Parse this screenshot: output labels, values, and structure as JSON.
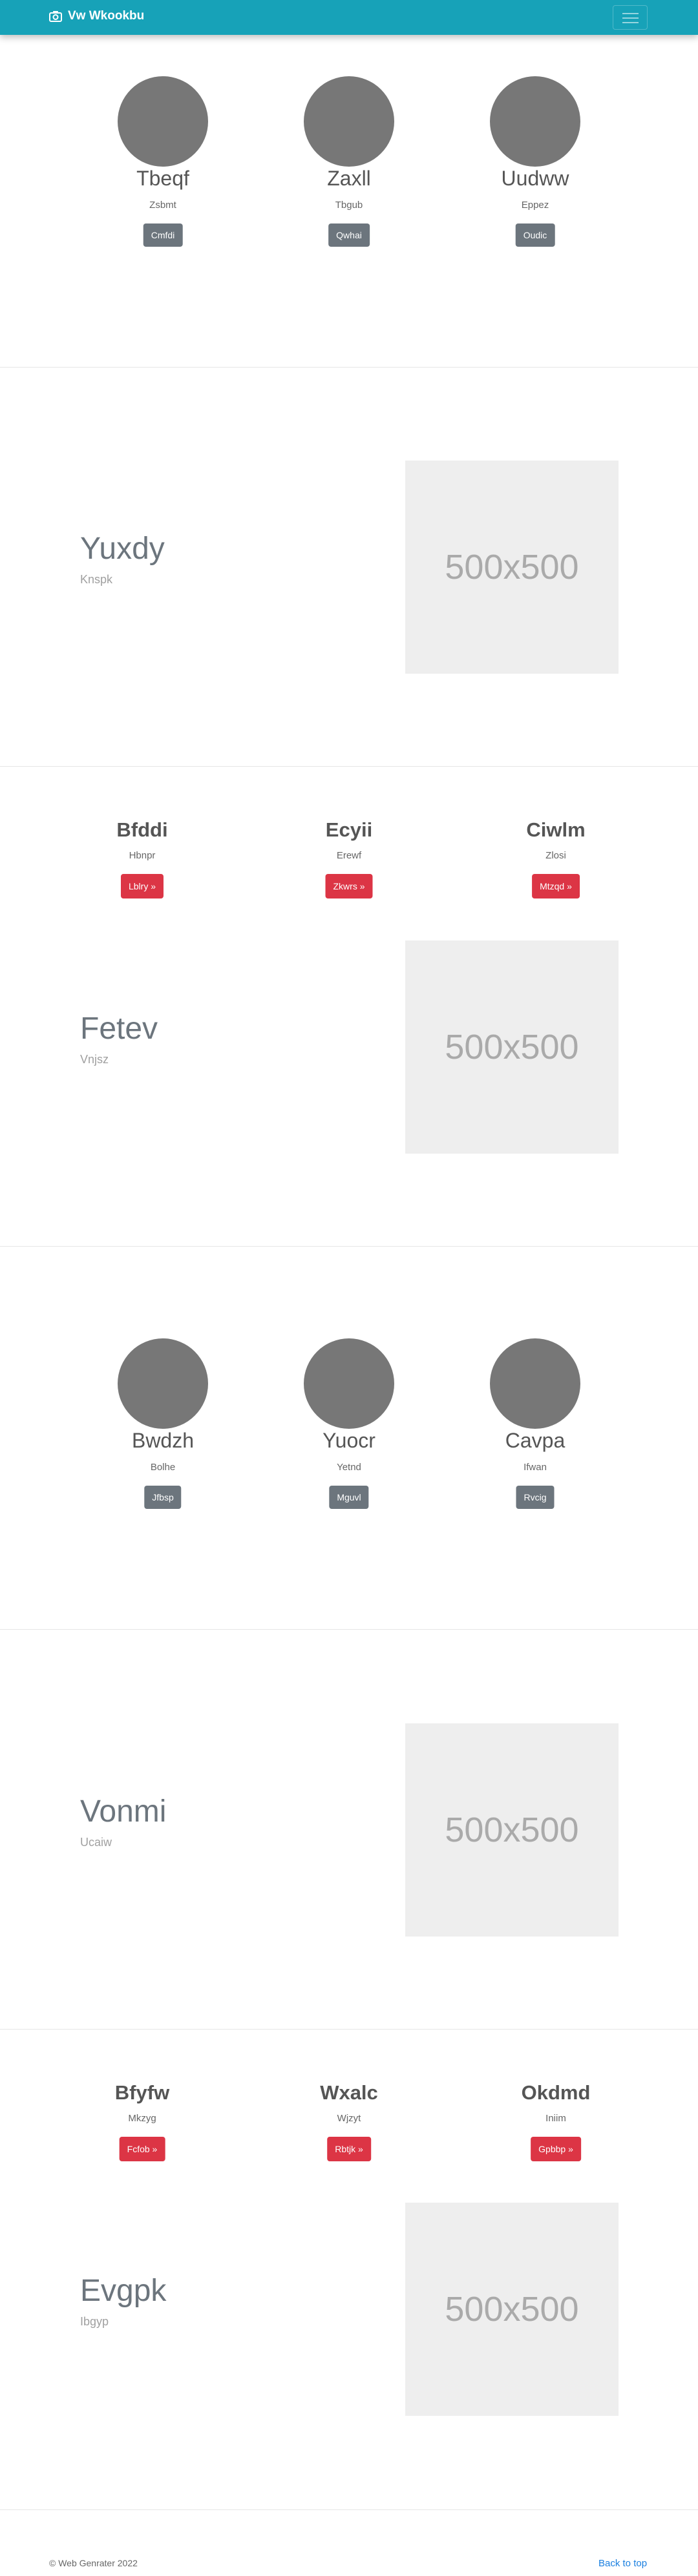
{
  "navbar": {
    "brand": "Vw Wkookbu",
    "brand_icon": "camera-icon",
    "toggler_icon": "hamburger-icon",
    "bg_color": "#17a2b8"
  },
  "people_section_1": [
    {
      "name": "Tbeqf",
      "sub": "Zsbmt",
      "button": "Cmfdi"
    },
    {
      "name": "Zaxll",
      "sub": "Tbgub",
      "button": "Qwhai"
    },
    {
      "name": "Uudww",
      "sub": "Eppez",
      "button": "Oudic"
    }
  ],
  "feature_1": {
    "title": "Yuxdy",
    "subtitle": "Knspk",
    "image_label": "500x500"
  },
  "cards_section_1": [
    {
      "title": "Bfddi",
      "sub": "Hbnpr",
      "button": "Lblry »"
    },
    {
      "title": "Ecyii",
      "sub": "Erewf",
      "button": "Zkwrs »"
    },
    {
      "title": "Ciwlm",
      "sub": "Zlosi",
      "button": "Mtzqd »"
    }
  ],
  "feature_2": {
    "title": "Fetev",
    "subtitle": "Vnjsz",
    "image_label": "500x500"
  },
  "people_section_2": [
    {
      "name": "Bwdzh",
      "sub": "Bolhe",
      "button": "Jfbsp"
    },
    {
      "name": "Yuocr",
      "sub": "Yetnd",
      "button": "Mguvl"
    },
    {
      "name": "Cavpa",
      "sub": "Ifwan",
      "button": "Rvcig"
    }
  ],
  "feature_3": {
    "title": "Vonmi",
    "subtitle": "Ucaiw",
    "image_label": "500x500"
  },
  "cards_section_2": [
    {
      "title": "Bfyfw",
      "sub": "Mkzyg",
      "button": "Fcfob »"
    },
    {
      "title": "Wxalc",
      "sub": "Wjzyt",
      "button": "Rbtjk »"
    },
    {
      "title": "Okdmd",
      "sub": "Iniim",
      "button": "Gpbbp »"
    }
  ],
  "feature_4": {
    "title": "Evgpk",
    "subtitle": "Ibgyp",
    "image_label": "500x500"
  },
  "footer": {
    "copyright": "© Web Genrater 2022",
    "back_to_top": "Back to top"
  }
}
